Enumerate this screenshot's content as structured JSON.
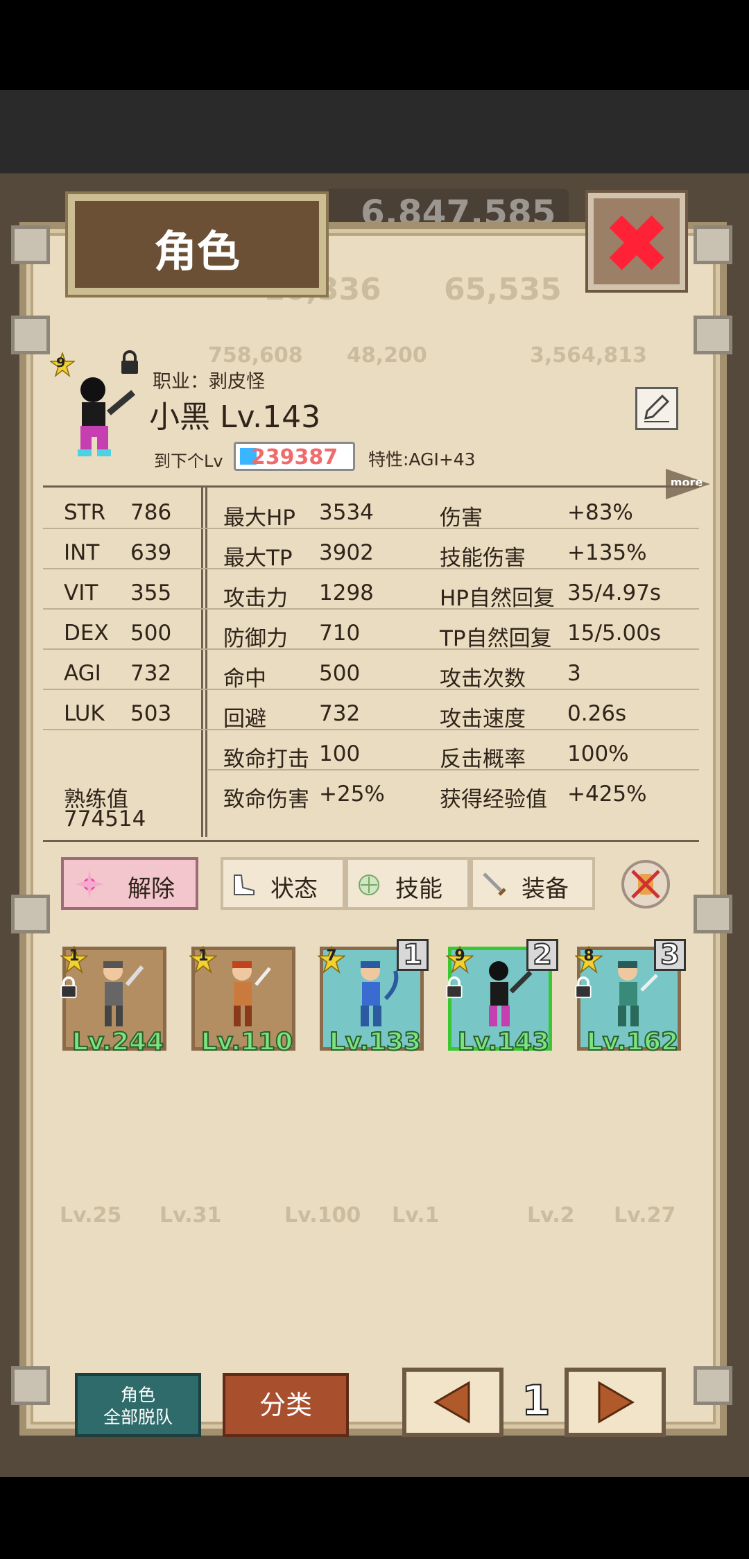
{
  "background": {
    "gold": "6,847,585",
    "stats_row1": [
      "10,336",
      "65,535"
    ],
    "stats_row2": [
      "758,608",
      "48,200",
      "3,564,813"
    ],
    "bottom_lv": [
      "Lv.25",
      "Lv.31",
      "Lv.100",
      "Lv.1",
      "Lv.2",
      "Lv.27"
    ]
  },
  "window": {
    "title": "角色",
    "close_icon": "close-x-icon"
  },
  "character": {
    "rank": "9",
    "job_label": "职业：剥皮怪",
    "name_level": "小黑 Lv.143",
    "next_lv_label": "到下个Lv",
    "exp_to_next": "239387",
    "exp_progress": 0.15,
    "trait": "特性:AGI+43",
    "more_label": "more"
  },
  "stats": {
    "base": [
      {
        "k": "STR",
        "v": "786"
      },
      {
        "k": "INT",
        "v": "639"
      },
      {
        "k": "VIT",
        "v": "355"
      },
      {
        "k": "DEX",
        "v": "500"
      },
      {
        "k": "AGI",
        "v": "732"
      },
      {
        "k": "LUK",
        "v": "503"
      }
    ],
    "proficiency_label": "熟练值",
    "proficiency_value": "774514",
    "combat": [
      {
        "k": "最大HP",
        "v": "3534"
      },
      {
        "k": "最大TP",
        "v": "3902"
      },
      {
        "k": "攻击力",
        "v": "1298"
      },
      {
        "k": "防御力",
        "v": "710"
      },
      {
        "k": "命中",
        "v": "500"
      },
      {
        "k": "回避",
        "v": "732"
      },
      {
        "k": "致命打击",
        "v": "100"
      },
      {
        "k": "致命伤害",
        "v": "+25%"
      }
    ],
    "bonus": [
      {
        "k": "伤害",
        "v": "+83%"
      },
      {
        "k": "技能伤害",
        "v": "+135%"
      },
      {
        "k": "HP自然回复",
        "v": "35/4.97s"
      },
      {
        "k": "TP自然回复",
        "v": "15/5.00s"
      },
      {
        "k": "攻击次数",
        "v": "3"
      },
      {
        "k": "攻击速度",
        "v": "0.26s"
      },
      {
        "k": "反击概率",
        "v": "100%"
      },
      {
        "k": "获得经验值",
        "v": "+425%"
      }
    ]
  },
  "tabs": {
    "release": "解除",
    "status": "状态",
    "skills": "技能",
    "equipment": "装备"
  },
  "roster": [
    {
      "rank": "1",
      "level": "Lv.244",
      "bg": "#b48e63",
      "slot": ""
    },
    {
      "rank": "1",
      "level": "Lv.110",
      "bg": "#b48e63",
      "slot": ""
    },
    {
      "rank": "7",
      "level": "Lv.133",
      "bg": "#78c7c6",
      "slot": "1"
    },
    {
      "rank": "9",
      "level": "Lv.143",
      "bg": "#78c7c6",
      "slot": "2"
    },
    {
      "rank": "8",
      "level": "Lv.162",
      "bg": "#78c7c6",
      "slot": "3"
    }
  ],
  "bottom": {
    "dismiss_line1": "角色",
    "dismiss_line2": "全部脱队",
    "sort": "分类",
    "page": "1"
  }
}
